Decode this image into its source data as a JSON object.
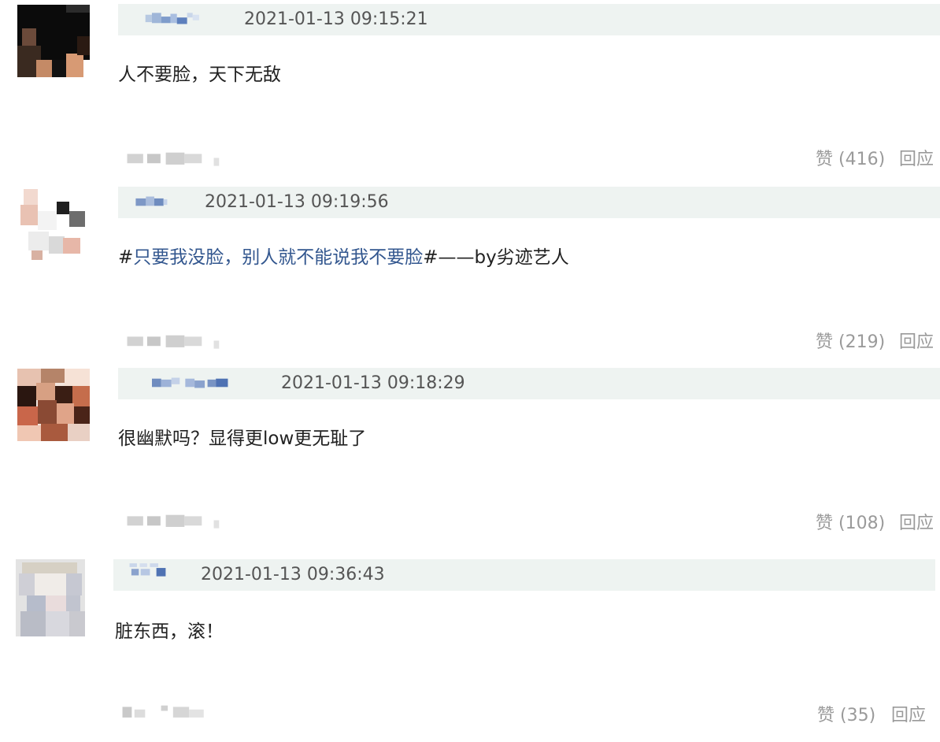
{
  "comments": [
    {
      "timestamp": "2021-01-13 09:15:21",
      "text": "人不要脸，天下无敌",
      "likes_label": "赞 (416)",
      "reply_label": "回应"
    },
    {
      "timestamp": "2021-01-13 09:19:56",
      "text_prefix": "#",
      "text_topic": "只要我没脸，别人就不能说我不要脸",
      "text_suffix": "#——by劣迹艺人",
      "likes_label": "赞 (219)",
      "reply_label": "回应"
    },
    {
      "timestamp": "2021-01-13 09:18:29",
      "text": "很幽默吗？显得更low更无耻了",
      "likes_label": "赞 (108)",
      "reply_label": "回应"
    },
    {
      "timestamp": "2021-01-13 09:36:43",
      "text": "脏东西，滚！",
      "likes_label": "赞 (35)",
      "reply_label": "回应"
    }
  ],
  "colors": {
    "header_bg": "#eef3f1",
    "topic_link": "#33578f",
    "action_text": "#9a9a9a",
    "timestamp_text": "#555555"
  },
  "icons": [
    "avatar-1",
    "avatar-2",
    "avatar-3",
    "avatar-4"
  ]
}
